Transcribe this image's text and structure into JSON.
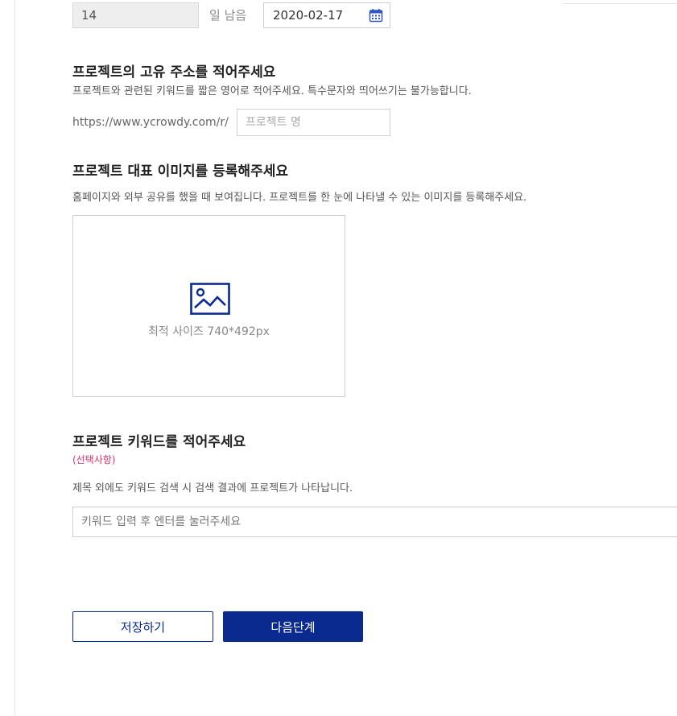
{
  "duration": {
    "days_value": "14",
    "days_left_label": "일 남음",
    "end_date": "2020-02-17"
  },
  "url_section": {
    "title": "프로젝트의 고유 주소를 적어주세요",
    "description": "프로젝트와 관련된 키워드를 짧은 영어로 적어주세요. 특수문자와 띄어쓰기는 불가능합니다.",
    "url_prefix": "https://www.ycrowdy.com/r/",
    "input_placeholder": "프로젝트 명"
  },
  "image_section": {
    "title": "프로젝트 대표 이미지를 등록해주세요",
    "description": "홈페이지와 외부 공유를 했을 때 보여집니다. 프로젝트를 한 눈에 나타낼 수 있는 이미지를 등록해주세요.",
    "upload_hint": "최적 사이즈 740*492px",
    "icon": "image-icon"
  },
  "keyword_section": {
    "title": "프로젝트 키워드를 적어주세요",
    "optional_label": "(선택사항)",
    "description": "제목 외에도 키워드 검색 시 검색 결과에 프로젝트가 나타납니다.",
    "input_placeholder": "키워드 입력 후 엔터를 눌러주세요"
  },
  "actions": {
    "save_label": "저장하기",
    "next_label": "다음단계"
  },
  "colors": {
    "accent": "#0a2a8f",
    "optional_tag": "#d6336c",
    "border": "#cfcfcf"
  }
}
